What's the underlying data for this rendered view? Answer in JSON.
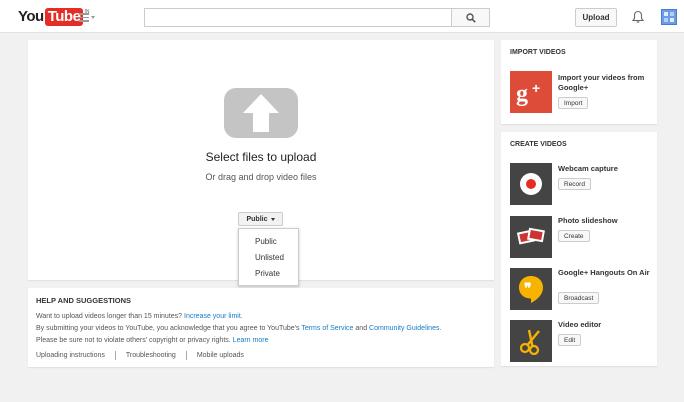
{
  "header": {
    "logo_you": "You",
    "logo_tube": "Tube",
    "logo_country": "IN",
    "search": {
      "value": "",
      "placeholder": ""
    },
    "upload_label": "Upload"
  },
  "upload": {
    "title": "Select files to upload",
    "subtitle": "Or drag and drop video files",
    "privacy_selected": "Public",
    "privacy_options": [
      "Public",
      "Unlisted",
      "Private"
    ]
  },
  "help": {
    "title": "HELP AND SUGGESTIONS",
    "line1_text": "Want to upload videos longer than 15 minutes?",
    "line1_link": "Increase your limit.",
    "line2_text": "By submitting your videos to YouTube, you acknowledge that you agree to YouTube's",
    "line2_tos": "Terms of Service",
    "line2_and": "and",
    "line2_guidelines": "Community Guidelines.",
    "line3_text": "Please be sure not to violate others' copyright or privacy rights.",
    "line3_link": "Learn more",
    "links": [
      "Uploading instructions",
      "Troubleshooting",
      "Mobile uploads"
    ]
  },
  "import": {
    "title": "IMPORT VIDEOS",
    "item_label": "Import your videos from Google+",
    "item_button": "Import"
  },
  "create": {
    "title": "CREATE VIDEOS",
    "items": [
      {
        "label": "Webcam capture",
        "button": "Record",
        "icon": "webcam-icon"
      },
      {
        "label": "Photo slideshow",
        "button": "Create",
        "icon": "slideshow-icon"
      },
      {
        "label": "Google+ Hangouts On Air",
        "button": "Broadcast",
        "icon": "hangouts-icon"
      },
      {
        "label": "Video editor",
        "button": "Edit",
        "icon": "scissors-icon"
      }
    ]
  },
  "colors": {
    "brand_red": "#e52d27",
    "link_blue": "#167ac6",
    "gplus_red": "#dd4b39",
    "hangouts_yellow": "#f6b400",
    "dark_thumb": "#444444"
  }
}
